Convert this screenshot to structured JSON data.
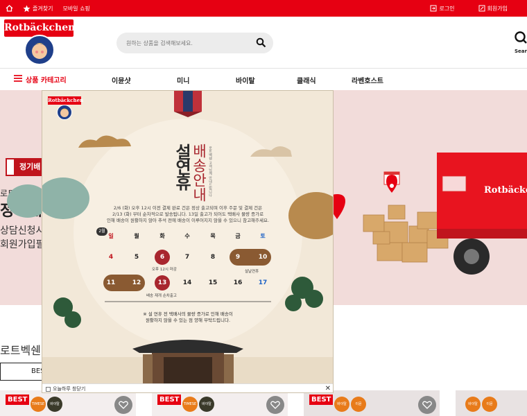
{
  "topbar": {
    "bookmark": "즐겨찾기",
    "mobile": "모바일 쇼핑",
    "login": "로그인",
    "signup": "회원가입"
  },
  "header": {
    "logo": "Rotbäckchen",
    "search_placeholder": "원하는 상품을 검색해보세요.",
    "search_label": "Searc"
  },
  "nav": {
    "category": "상품 카테고리",
    "items": [
      "이뮨샷",
      "미니",
      "바이탈",
      "클래식",
      "라벤호스트"
    ]
  },
  "banner": {
    "tag": "정기배",
    "line1": "로트벡쉔 이",
    "line2": "정기배",
    "line3": "상담신청시",
    "line4": "회원가입필",
    "truck_brand": "Rotbäckchen"
  },
  "section": {
    "title": "로트벡쉔",
    "tab": "BES"
  },
  "cards": [
    {
      "best": "BEST",
      "badge1": "TIMESE",
      "badge2": "바이탈"
    },
    {
      "best": "BEST",
      "badge1": "TIMESE",
      "badge2": "바이탈"
    },
    {
      "best": "BEST",
      "badge1": "바이탈",
      "badge2": "이뮨"
    },
    {
      "badge1": "바이탈",
      "badge2": "이뮨"
    }
  ],
  "popup": {
    "logo": "Rotbäckchen",
    "title_main": "설연휴",
    "title_sub": "배송안내",
    "title_small": "로트벡쉔 고객님께 안내드립니다",
    "intro": [
      "2/6 (화) 오후 12시 이전 결제 완료 건은 정상 출고되며 이후 주문 및 결제 건은",
      "2/13 (화) 부터 순차적으로 발송됩니다. 13일 출고가 되어도 택배사 물량 증가로",
      "인해 배송이 원활하지 않아 추석 전에 배송이 이루어지지 않을 수 있으니 참고해주세요."
    ],
    "month": "2월",
    "dow": [
      "일",
      "월",
      "화",
      "수",
      "목",
      "금",
      "토"
    ],
    "week1": [
      "4",
      "5",
      "6",
      "7",
      "8",
      "9",
      "10"
    ],
    "week2": [
      "11",
      "12",
      "13",
      "14",
      "15",
      "16",
      "17"
    ],
    "note_cutoff": "오후 12시 마감",
    "note_holiday": "설날연휴",
    "note_resume": "배송 재개 순차출고",
    "footnote1": "※ 설 연휴 전 택배사의 물량 증가로 인해 배송이",
    "footnote2": "원활하지 않을 수 있는 점 양해 부탁드립니다.",
    "dont_show": "오늘하루 창닫기",
    "close": "✕"
  },
  "colors": {
    "brand_red": "#e60012",
    "popup_bg": "#f2e8d8",
    "holiday_brown": "#8a5a32",
    "sunday_red": "#c0141d",
    "saturday_blue": "#1e63c6"
  }
}
